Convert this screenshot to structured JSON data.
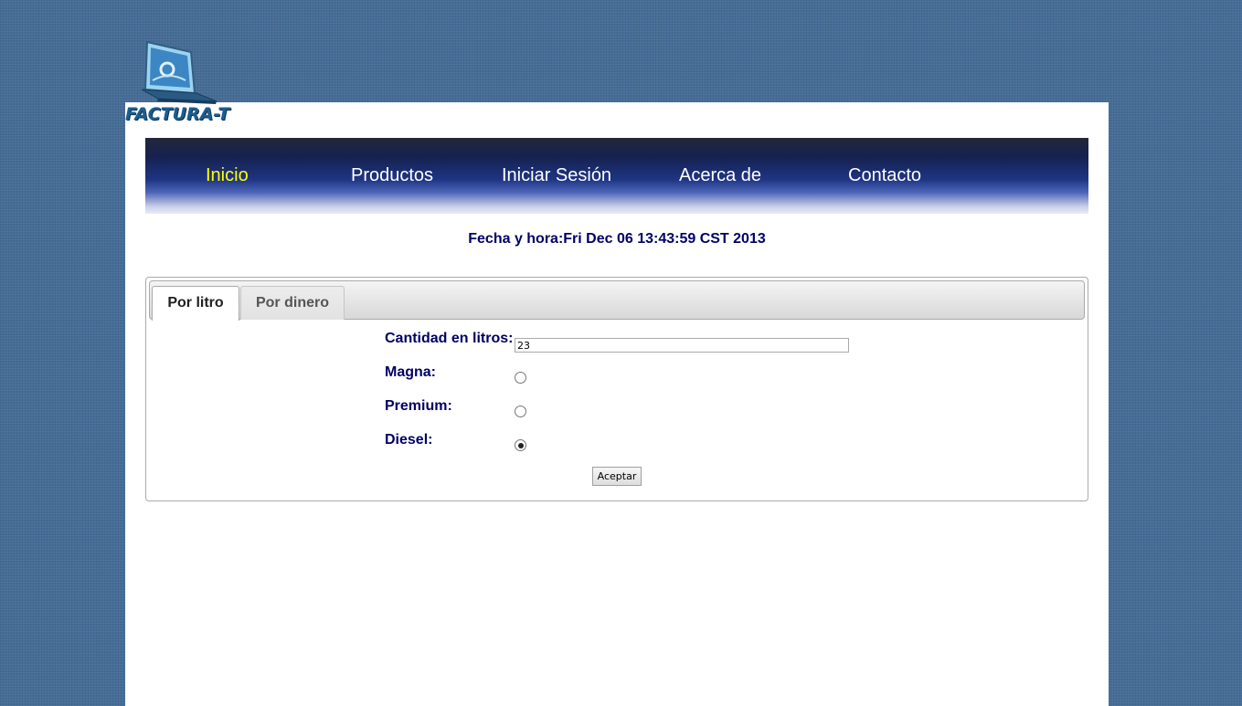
{
  "logo": {
    "text": "FACTURA-T",
    "icon": "laptop-logo-icon"
  },
  "nav": {
    "items": [
      {
        "label": "Inicio",
        "active": true
      },
      {
        "label": "Productos",
        "active": false
      },
      {
        "label": "Iniciar Sesión",
        "active": false
      },
      {
        "label": "Acerca de",
        "active": false
      },
      {
        "label": "Contacto",
        "active": false
      }
    ],
    "active_color": "#ffff00"
  },
  "datetime": "Fecha y hora:Fri Dec 06 13:43:59 CST 2013",
  "tabs": [
    {
      "label": "Por litro",
      "active": true
    },
    {
      "label": "Por dinero",
      "active": false
    }
  ],
  "form": {
    "quantity_label": "Cantidad en litros:",
    "quantity_value": "23",
    "fuel_options": [
      {
        "label": "Magna:",
        "checked": false
      },
      {
        "label": "Premium:",
        "checked": false
      },
      {
        "label": "Diesel:",
        "checked": true
      }
    ],
    "submit_label": "Aceptar"
  },
  "colors": {
    "background": "#466d97",
    "label_text": "#000066",
    "nav_dark": "#16214f"
  }
}
